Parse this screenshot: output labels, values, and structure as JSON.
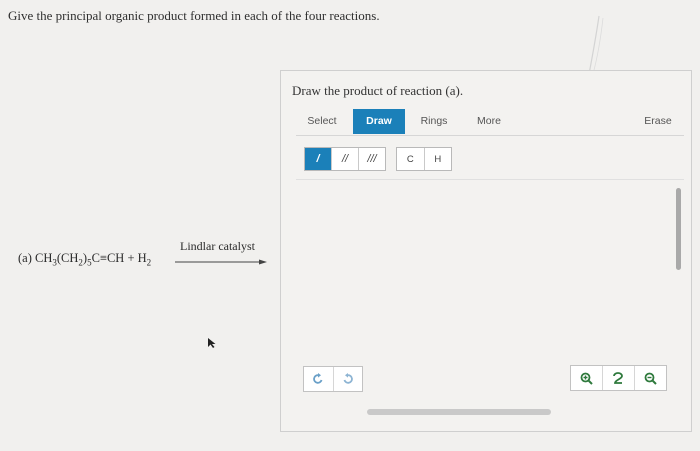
{
  "question": "Give the principal organic product formed in each of the four reactions.",
  "reaction": {
    "label": "(a)",
    "parts": [
      "CH",
      "3",
      "(CH",
      "2",
      ")",
      "5",
      "C≡CH + H",
      "2"
    ],
    "catalyst": "Lindlar catalyst"
  },
  "panel": {
    "title": "Draw the product of reaction (a).",
    "tabs": {
      "select": "Select",
      "draw": "Draw",
      "rings": "Rings",
      "more": "More",
      "erase": "Erase"
    },
    "bonds": {
      "single": "/",
      "double": "//",
      "triple": "///"
    },
    "atoms": {
      "carbon": "C",
      "hydrogen": "H"
    },
    "active_tab": "Draw",
    "active_bond": "single"
  },
  "colors": {
    "accent": "#1b80b9",
    "undo_icon": "#6aa0c8",
    "zoom_icon": "#2f7a3d"
  },
  "icons": [
    "undo-icon",
    "redo-icon",
    "zoom-in-icon",
    "reset-zoom-icon",
    "zoom-out-icon"
  ]
}
